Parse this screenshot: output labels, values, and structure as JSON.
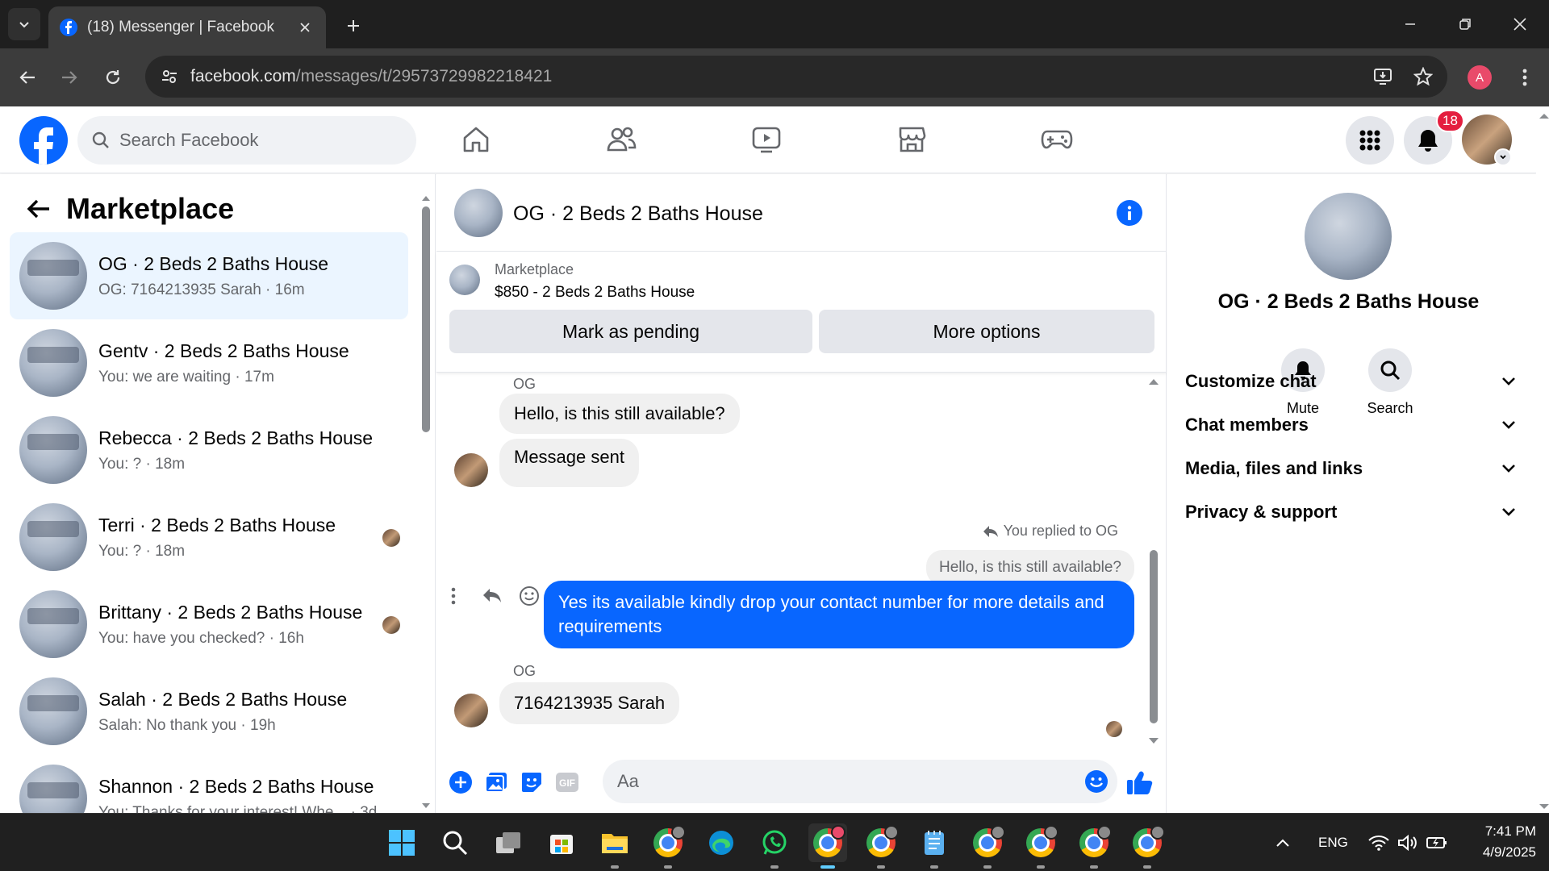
{
  "browser": {
    "tab_title": "(18) Messenger | Facebook",
    "url_host": "facebook.com",
    "url_path": "/messages/t/29573729982218421",
    "profile_initial": "A"
  },
  "fb_header": {
    "search_placeholder": "Search Facebook",
    "notification_count": "18"
  },
  "sidebar": {
    "title": "Marketplace",
    "conversations": [
      {
        "name": "OG · 2 Beds 2 Baths House",
        "preview": "OG: 7164213935 Sarah · 16m",
        "active": true,
        "read_avatar": false
      },
      {
        "name": "Gentv · 2 Beds 2 Baths House",
        "preview": "You: we are waiting · 17m",
        "active": false,
        "read_avatar": false
      },
      {
        "name": "Rebecca · 2 Beds 2 Baths House",
        "preview": "You: ? · 18m",
        "active": false,
        "read_avatar": false
      },
      {
        "name": "Terri · 2 Beds 2 Baths House",
        "preview": "You: ? · 18m",
        "active": false,
        "read_avatar": true
      },
      {
        "name": "Brittany · 2 Beds 2 Baths House",
        "preview": "You: have you checked? · 16h",
        "active": false,
        "read_avatar": true
      },
      {
        "name": "Salah · 2 Beds 2 Baths House",
        "preview": "Salah: No thank you · 19h",
        "active": false,
        "read_avatar": false
      },
      {
        "name": "Shannon · 2 Beds 2 Baths House",
        "preview": "You: Thanks for your interest! Whe... · 3d",
        "active": false,
        "read_avatar": false
      }
    ]
  },
  "chat": {
    "title": "OG · 2 Beds 2 Baths House",
    "marketplace_label": "Marketplace",
    "listing": "$850 - 2 Beds 2 Baths House",
    "mark_pending": "Mark as pending",
    "more_options": "More options",
    "sender_1": "OG",
    "msg_1": "Hello, is this still available?",
    "msg_2": "Message sent",
    "replied_to": "You replied to OG",
    "quoted": "Hello, is this still available?",
    "reply_text": "Yes its available kindly drop your contact number for more details and requirements",
    "sender_2": "OG",
    "msg_3": "7164213935 Sarah",
    "composer_placeholder": "Aa"
  },
  "details": {
    "name": "OG · 2 Beds 2 Baths House",
    "mute": "Mute",
    "search": "Search",
    "sections": [
      "Customize chat",
      "Chat members",
      "Media, files and links",
      "Privacy & support"
    ]
  },
  "taskbar": {
    "lang": "ENG",
    "time": "7:41 PM",
    "date": "4/9/2025"
  },
  "colors": {
    "fb_blue": "#0866ff",
    "active_row": "#ebf5ff",
    "badge_red": "#e41e3f"
  }
}
